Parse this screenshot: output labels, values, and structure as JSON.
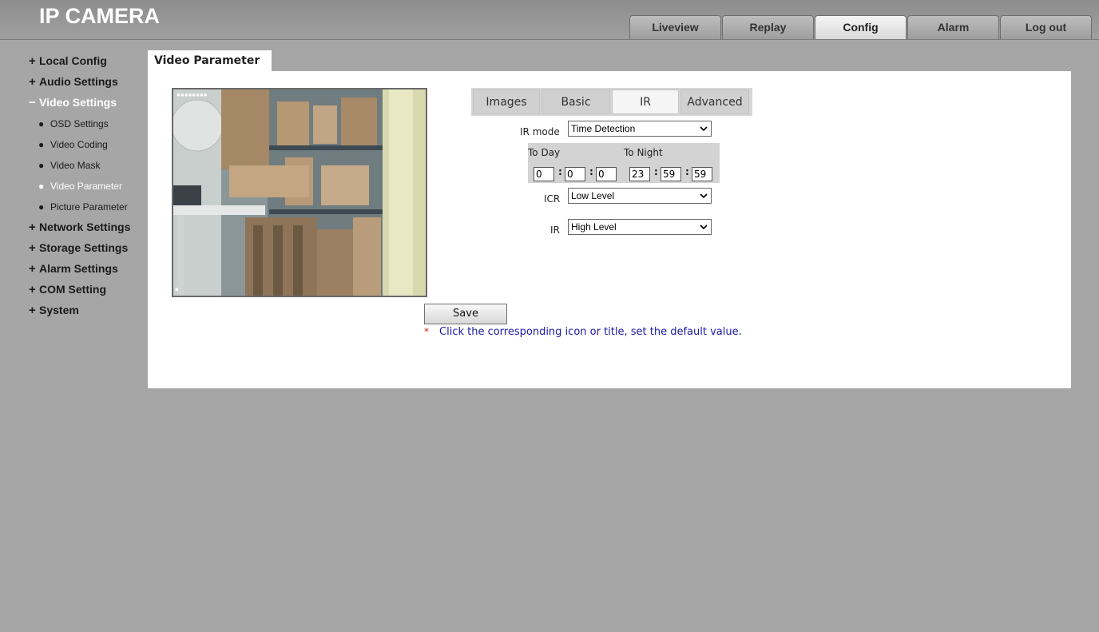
{
  "header": {
    "logo": "IP CAMERA",
    "tabs": [
      {
        "label": "Liveview",
        "active": false
      },
      {
        "label": "Replay",
        "active": false
      },
      {
        "label": "Config",
        "active": true
      },
      {
        "label": "Alarm",
        "active": false
      },
      {
        "label": "Log out",
        "active": false
      }
    ]
  },
  "sidebar": {
    "groups": [
      {
        "sign": "+",
        "label": "Local Config"
      },
      {
        "sign": "+",
        "label": "Audio Settings"
      },
      {
        "sign": "−",
        "label": "Video Settings"
      },
      {
        "sign": "+",
        "label": "Network Settings"
      },
      {
        "sign": "+",
        "label": "Storage Settings"
      },
      {
        "sign": "+",
        "label": "Alarm Settings"
      },
      {
        "sign": "+",
        "label": "COM Setting"
      },
      {
        "sign": "+",
        "label": "System"
      }
    ],
    "video_sub": [
      {
        "label": "OSD Settings"
      },
      {
        "label": "Video Coding"
      },
      {
        "label": "Video Mask"
      },
      {
        "label": "Video Parameter"
      },
      {
        "label": "Picture Parameter"
      }
    ]
  },
  "panel": {
    "title": "Video Parameter",
    "subtabs": [
      {
        "label": "Images"
      },
      {
        "label": "Basic"
      },
      {
        "label": "IR"
      },
      {
        "label": "Advanced"
      }
    ],
    "active_subtab": "IR",
    "ir_mode_label": "IR mode",
    "ir_mode_value": "Time Detection",
    "to_day_label": "To Day",
    "to_night_label": "To Night",
    "to_day": [
      "0",
      "0",
      "0"
    ],
    "to_night": [
      "23",
      "59",
      "59"
    ],
    "icr_label": "ICR",
    "icr_value": "Low Level",
    "ir_label": "IR",
    "ir_value": "High Level",
    "save_label": "Save",
    "note_star": "*",
    "note": "Click the corresponding icon or title, set the default value."
  },
  "colors": {
    "background": "#a6a6a6",
    "panel": "#ffffff",
    "note": "#1a1aa8",
    "star": "#e01b1b"
  }
}
